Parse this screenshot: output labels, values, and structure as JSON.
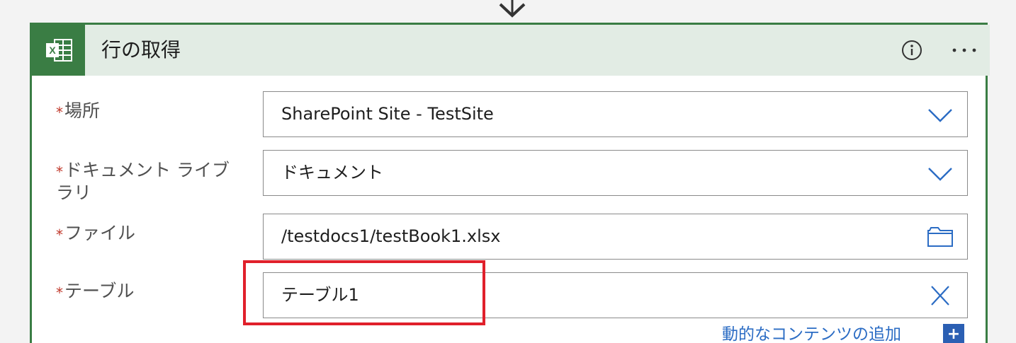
{
  "card": {
    "title": "行の取得",
    "app_icon": "excel-icon",
    "info_icon": "info-icon",
    "more_icon": "more-dots-icon",
    "accent_color": "#3a7d44",
    "header_color": "#e2ece4"
  },
  "fields": {
    "location": {
      "required_mark": "*",
      "label": "場所",
      "value": "SharePoint Site - TestSite",
      "icon": "chevron-down-icon"
    },
    "library": {
      "required_mark": "*",
      "label_line1": "ドキュメント ライブ",
      "label_line2": "ラリ",
      "value": "ドキュメント",
      "icon": "chevron-down-icon"
    },
    "file": {
      "required_mark": "*",
      "label": "ファイル",
      "value": "/testdocs1/testBook1.xlsx",
      "icon": "folder-icon"
    },
    "table": {
      "required_mark": "*",
      "label": "テーブル",
      "value": "テーブル1",
      "icon": "clear-icon"
    }
  },
  "dynamic_content": {
    "label": "動的なコンテンツの追加",
    "plus": "+"
  },
  "highlight_color": "#e0202b"
}
